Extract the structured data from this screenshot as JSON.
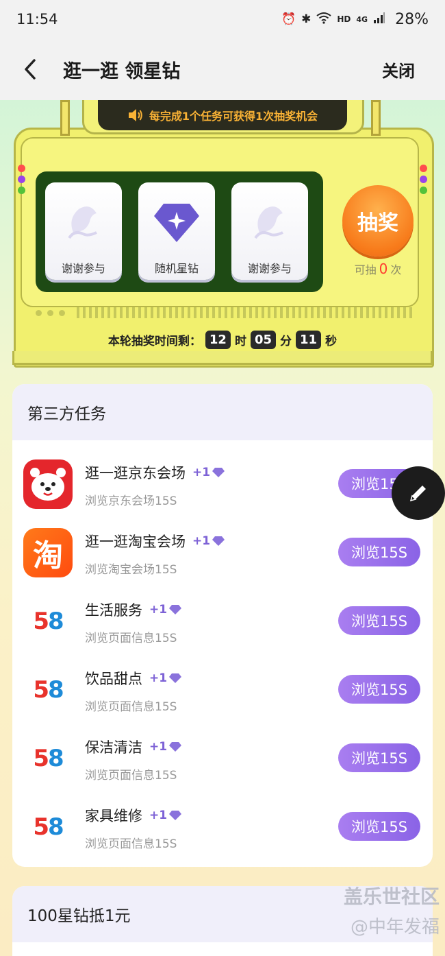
{
  "status_bar": {
    "time": "11:54",
    "network": "HD",
    "signal": "4G",
    "battery": "28%"
  },
  "header": {
    "title": "逛一逛 领星钻",
    "close_label": "关闭"
  },
  "lottery": {
    "notice": "每完成1个任务可获得1次抽奖机会",
    "reels": [
      {
        "label": "谢谢参与",
        "icon": "thanks-icon"
      },
      {
        "label": "随机星钻",
        "icon": "diamond-icon"
      },
      {
        "label": "谢谢参与",
        "icon": "thanks-icon"
      }
    ],
    "draw_label": "抽奖",
    "draw_prefix": "可抽",
    "draw_count": "0",
    "draw_suffix": "次",
    "timer_label": "本轮抽奖时间剩：",
    "hours": "12",
    "hours_unit": "时",
    "minutes": "05",
    "minutes_unit": "分",
    "seconds": "11",
    "seconds_unit": "秒"
  },
  "tasks": {
    "title": "第三方任务",
    "items": [
      {
        "name": "逛一逛京东会场",
        "reward": "+1",
        "desc": "浏览京东会场15S",
        "button": "浏览15S",
        "logo": "jd-logo"
      },
      {
        "name": "逛一逛淘宝会场",
        "reward": "+1",
        "desc": "浏览淘宝会场15S",
        "button": "浏览15S",
        "logo": "taobao-logo",
        "logo_text": "淘"
      },
      {
        "name": "生活服务",
        "reward": "+1",
        "desc": "浏览页面信息15S",
        "button": "浏览15S",
        "logo": "58-logo"
      },
      {
        "name": "饮品甜点",
        "reward": "+1",
        "desc": "浏览页面信息15S",
        "button": "浏览15S",
        "logo": "58-logo"
      },
      {
        "name": "保洁清洁",
        "reward": "+1",
        "desc": "浏览页面信息15S",
        "button": "浏览15S",
        "logo": "58-logo"
      },
      {
        "name": "家具维修",
        "reward": "+1",
        "desc": "浏览页面信息15S",
        "button": "浏览15S",
        "logo": "58-logo"
      }
    ]
  },
  "section2": {
    "title": "100星钻抵1元"
  },
  "watermark": {
    "line1": "盖乐世社区",
    "line2": "@中年发福"
  },
  "colors": {
    "accent": "#8a63e6",
    "draw_button": "#f77a1a",
    "reel_panel": "#1e4a14",
    "machine": "#f1f06e"
  }
}
